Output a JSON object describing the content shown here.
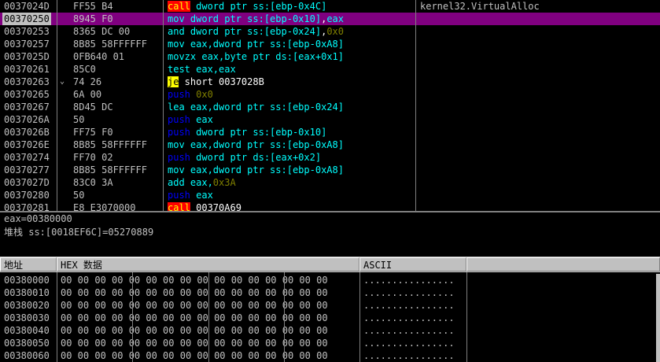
{
  "disasm": [
    {
      "addr": "0037024D",
      "hex": "FF55 B4",
      "jump": "",
      "tokens": [
        {
          "t": "call",
          "c": "t-call"
        },
        {
          "t": " dword ptr ss:[ebp-0x4C]",
          "c": "t-cyan"
        }
      ],
      "comment": "kernel32.VirtualAlloc",
      "selected": false
    },
    {
      "addr": "00370250",
      "hex": "8945 F0",
      "jump": "",
      "tokens": [
        {
          "t": "mov",
          "c": "t-cyan"
        },
        {
          "t": " dword ptr ss:[ebp-0x10]",
          "c": "t-cyan"
        },
        {
          "t": ",",
          "c": "t-white"
        },
        {
          "t": "eax",
          "c": "t-cyan"
        }
      ],
      "comment": "",
      "selected": true
    },
    {
      "addr": "00370253",
      "hex": "8365 DC 00",
      "jump": "",
      "tokens": [
        {
          "t": "and dword ptr ss:[ebp-0x24]",
          "c": "t-cyan"
        },
        {
          "t": ",",
          "c": "t-white"
        },
        {
          "t": "0x0",
          "c": "t-imm"
        }
      ],
      "comment": "",
      "selected": false
    },
    {
      "addr": "00370257",
      "hex": "8B85 58FFFFFF",
      "jump": "",
      "tokens": [
        {
          "t": "mov eax,dword ptr ss:[ebp-0xA8]",
          "c": "t-cyan"
        }
      ],
      "comment": "",
      "selected": false
    },
    {
      "addr": "0037025D",
      "hex": "0FB640 01",
      "jump": "",
      "tokens": [
        {
          "t": "movzx eax,byte ptr ds:[eax+0x1]",
          "c": "t-cyan"
        }
      ],
      "comment": "",
      "selected": false
    },
    {
      "addr": "00370261",
      "hex": "85C0",
      "jump": "",
      "tokens": [
        {
          "t": "test eax,eax",
          "c": "t-cyan"
        }
      ],
      "comment": "",
      "selected": false
    },
    {
      "addr": "00370263",
      "hex": "74 26",
      "jump": "v",
      "tokens": [
        {
          "t": "je",
          "c": "t-jcc"
        },
        {
          "t": " short 0037028B",
          "c": "t-jtgt"
        }
      ],
      "comment": "",
      "selected": false
    },
    {
      "addr": "00370265",
      "hex": "6A 00",
      "jump": "",
      "tokens": [
        {
          "t": "push",
          "c": "t-blue"
        },
        {
          "t": " 0x0",
          "c": "t-imm"
        }
      ],
      "comment": "",
      "selected": false
    },
    {
      "addr": "00370267",
      "hex": "8D45 DC",
      "jump": "",
      "tokens": [
        {
          "t": "lea eax,dword ptr ss:[ebp-0x24]",
          "c": "t-cyan"
        }
      ],
      "comment": "",
      "selected": false
    },
    {
      "addr": "0037026A",
      "hex": "50",
      "jump": "",
      "tokens": [
        {
          "t": "push",
          "c": "t-blue"
        },
        {
          "t": " eax",
          "c": "t-cyan"
        }
      ],
      "comment": "",
      "selected": false
    },
    {
      "addr": "0037026B",
      "hex": "FF75 F0",
      "jump": "",
      "tokens": [
        {
          "t": "push",
          "c": "t-blue"
        },
        {
          "t": " dword ptr ss:[ebp-0x10]",
          "c": "t-cyan"
        }
      ],
      "comment": "",
      "selected": false
    },
    {
      "addr": "0037026E",
      "hex": "8B85 58FFFFFF",
      "jump": "",
      "tokens": [
        {
          "t": "mov eax,dword ptr ss:[ebp-0xA8]",
          "c": "t-cyan"
        }
      ],
      "comment": "",
      "selected": false
    },
    {
      "addr": "00370274",
      "hex": "FF70 02",
      "jump": "",
      "tokens": [
        {
          "t": "push",
          "c": "t-blue"
        },
        {
          "t": " dword ptr ds:[eax+0x2]",
          "c": "t-cyan"
        }
      ],
      "comment": "",
      "selected": false
    },
    {
      "addr": "00370277",
      "hex": "8B85 58FFFFFF",
      "jump": "",
      "tokens": [
        {
          "t": "mov eax,dword ptr ss:[ebp-0xA8]",
          "c": "t-cyan"
        }
      ],
      "comment": "",
      "selected": false
    },
    {
      "addr": "0037027D",
      "hex": "83C0 3A",
      "jump": "",
      "tokens": [
        {
          "t": "add eax,",
          "c": "t-cyan"
        },
        {
          "t": "0x3A",
          "c": "t-imm"
        }
      ],
      "comment": "",
      "selected": false
    },
    {
      "addr": "00370280",
      "hex": "50",
      "jump": "",
      "tokens": [
        {
          "t": "push",
          "c": "t-blue"
        },
        {
          "t": " eax",
          "c": "t-cyan"
        }
      ],
      "comment": "",
      "selected": false
    },
    {
      "addr": "00370281",
      "hex": "E8 E3070000",
      "jump": "",
      "tokens": [
        {
          "t": "call",
          "c": "t-call"
        },
        {
          "t": " 00370A69",
          "c": "t-white"
        }
      ],
      "comment": "",
      "selected": false
    }
  ],
  "info": {
    "line1": "eax=00380000",
    "line2": "堆栈 ss:[0018EF6C]=05270889"
  },
  "dump_headers": {
    "address": "地址",
    "hex": "HEX 数据",
    "ascii": "ASCII"
  },
  "dump_rows": [
    {
      "addr": "00380000",
      "hex": "00 00 00 00 00 00 00 00 00 00 00 00 00 00 00 00",
      "ascii": "................"
    },
    {
      "addr": "00380010",
      "hex": "00 00 00 00 00 00 00 00 00 00 00 00 00 00 00 00",
      "ascii": "................"
    },
    {
      "addr": "00380020",
      "hex": "00 00 00 00 00 00 00 00 00 00 00 00 00 00 00 00",
      "ascii": "................"
    },
    {
      "addr": "00380030",
      "hex": "00 00 00 00 00 00 00 00 00 00 00 00 00 00 00 00",
      "ascii": "................"
    },
    {
      "addr": "00380040",
      "hex": "00 00 00 00 00 00 00 00 00 00 00 00 00 00 00 00",
      "ascii": "................"
    },
    {
      "addr": "00380050",
      "hex": "00 00 00 00 00 00 00 00 00 00 00 00 00 00 00 00",
      "ascii": "................"
    },
    {
      "addr": "00380060",
      "hex": "00 00 00 00 00 00 00 00 00 00 00 00 00 00 00 00",
      "ascii": "................"
    }
  ]
}
